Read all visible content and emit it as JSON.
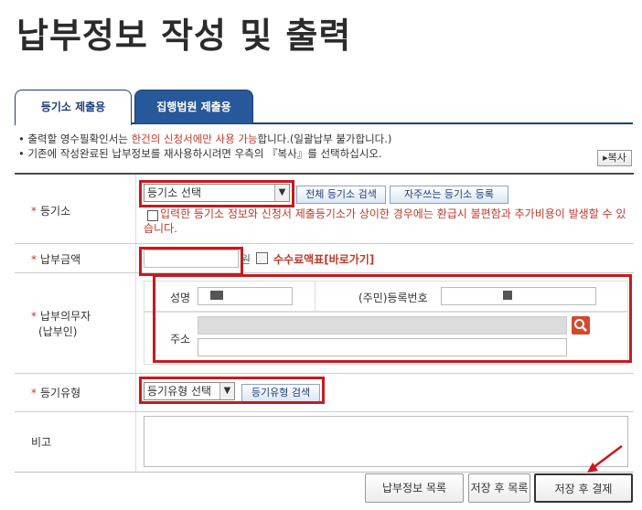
{
  "page": {
    "title": "납부정보 작성 및 출력"
  },
  "tabs": [
    {
      "label": "등기소 제출용",
      "active": true
    },
    {
      "label": "집행법원 제출용",
      "active": false
    }
  ],
  "notice": {
    "line1_a": "• 출력할 영수필확인서는 ",
    "line1_b": "한건의 신청서에만 사용 가능",
    "line1_c": "합니다.(일괄납부 불가합니다.)",
    "line2": "• 기존에 작성완료된 납부정보를 재사용하시려면 우측의 『복사』를 선택하십시오.",
    "copy_button": "▸복사"
  },
  "form": {
    "registry": {
      "label": "등기소",
      "select_value": "등기소 선택",
      "search_all_button": "전체 등기소 검색",
      "favorites_button": "자주쓰는 등기소 등록",
      "warning": "입력한 등기소 정보와 신청서 제출등기소가 상이한 경우에는 환급시 불편함과 추가비용이 발생할 수 있습니다."
    },
    "amount": {
      "label": "납부금액",
      "value": "",
      "unit": "원",
      "fee_link": "수수료액표[바로가기]"
    },
    "payer": {
      "label_line1": "납부의무자",
      "label_line2": "(납부인)",
      "name_label": "성명",
      "id_label": "(주민)등록번호",
      "address_label": "주소"
    },
    "reg_type": {
      "label": "등기유형",
      "select_value": "등기유형 선택",
      "search_button": "등기유형 검색"
    },
    "remarks": {
      "label": "비고",
      "value": ""
    }
  },
  "footer": {
    "list_button": "납부정보 목록",
    "save_list_button": "저장 후 목록",
    "save_pay_button": "저장 후 결제"
  },
  "colors": {
    "accent": "#27589a",
    "highlight": "#c8191f",
    "required": "#c0392b"
  }
}
